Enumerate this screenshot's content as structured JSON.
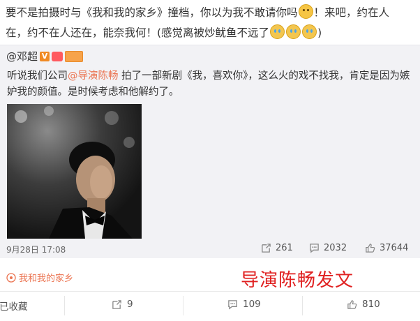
{
  "post": {
    "text_a": "要不是拍摄时与《我和我的家乡》撞档，你以为我不敢请你吗",
    "text_b": "！来吧，约在人在，约不在人还在，能奈我何！(感觉离被炒鱿鱼不远了",
    "text_c": ")",
    "emojis": [
      "kiss-icon",
      "laugh-cry-icon",
      "laugh-cry-icon",
      "laugh-cry-icon"
    ]
  },
  "quote": {
    "author": "@邓超",
    "text_before": "听说我们公司",
    "mention": "@导演陈畅",
    "text_after": " 拍了一部新剧《我，喜欢你》，这么火的戏不找我，肯定是因为嫉妒我的颜值。是时候考虑和他解约了。",
    "time": "9月28日 17:08",
    "reposts": "261",
    "comments": "2032",
    "likes": "37644"
  },
  "topic": {
    "label": "我和我的家乡"
  },
  "overlay": {
    "title": "导演陈畅发文"
  },
  "actions": {
    "favorite": "已收藏",
    "repost": "9",
    "comment": "109",
    "like": "810"
  },
  "colors": {
    "accent": "#eb7350",
    "overlay_red": "#e02020",
    "quote_bg": "#f2f2f5"
  }
}
